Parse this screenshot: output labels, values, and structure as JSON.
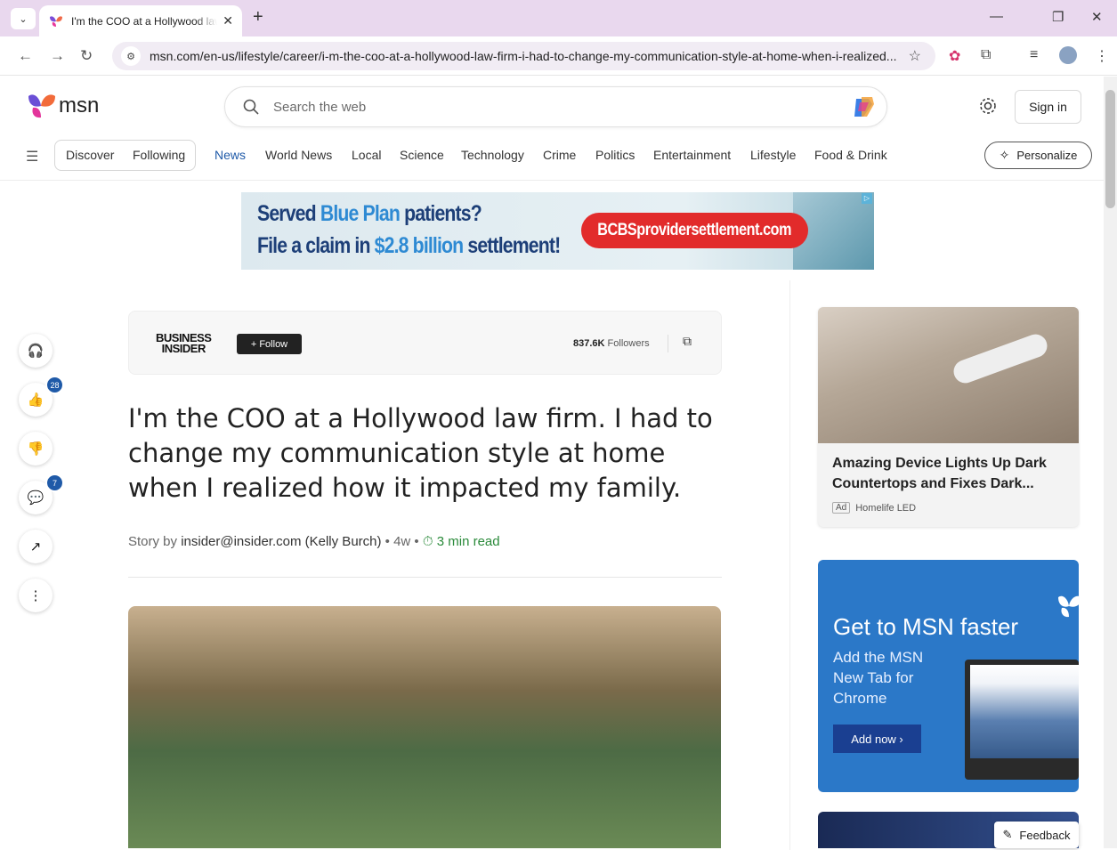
{
  "browser": {
    "tab_title": "I'm the COO at a Hollywood law firm. I had to change my communication style at home",
    "url": "msn.com/en-us/lifestyle/career/i-m-the-coo-at-a-hollywood-law-firm-i-had-to-change-my-communication-style-at-home-when-i-realized..."
  },
  "header": {
    "logo_text": "msn",
    "search_placeholder": "Search the web",
    "sign_in": "Sign in"
  },
  "nav": {
    "pills": [
      "Discover",
      "Following"
    ],
    "items": [
      "News",
      "World News",
      "Local",
      "Science",
      "Technology",
      "Crime",
      "Politics",
      "Entertainment",
      "Lifestyle",
      "Food & Drink"
    ],
    "active": "News",
    "personalize": "Personalize"
  },
  "ad_banner": {
    "line1_a": "Served ",
    "line1_hl": "Blue Plan",
    "line1_b": " patients?",
    "line2_a": "File a claim in ",
    "line2_hl": "$2.8 billion",
    "line2_b": " settlement!",
    "cta": "BCBSprovidersettlement.com"
  },
  "rail": {
    "like_count": "28",
    "comment_count": "7"
  },
  "article": {
    "publisher": "BUSINESS\nINSIDER",
    "follow": "+ Follow",
    "followers_count": "837.6K",
    "followers_label": " Followers",
    "headline": "I'm the COO at a Hollywood law firm. I had to change my communication style at home when I realized how it impacted my family.",
    "byline_prefix": "Story by ",
    "author": "insider@insider.com (Kelly Burch)",
    "age": " • 4w • ",
    "read_time": "3 min read"
  },
  "right_rail": {
    "card1_title": "Amazing Device Lights Up Dark Countertops and Fixes Dark...",
    "card1_ad": "Ad",
    "card1_sponsor": "Homelife LED",
    "card2_title": "Get to MSN faster",
    "card2_sub": "Add the MSN New Tab for Chrome",
    "card2_btn": "Add now ›",
    "feedback": "Feedback"
  },
  "colors": {
    "accent": "#1f5aa8",
    "read_time": "#2a8a3a",
    "promo_blue": "#2b78c8",
    "ad_red": "#e22b2b"
  }
}
